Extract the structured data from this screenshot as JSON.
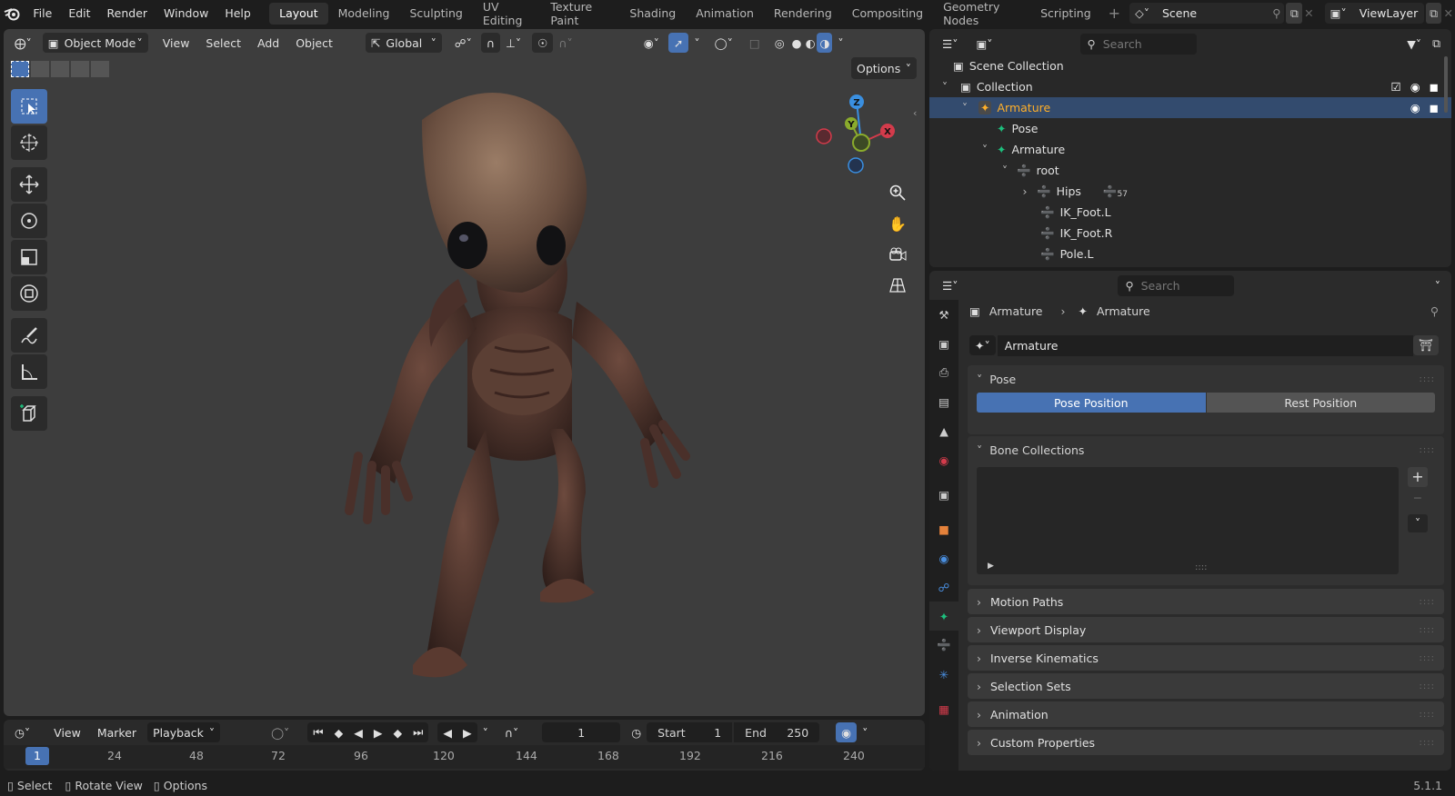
{
  "top_menu": [
    "File",
    "Edit",
    "Render",
    "Window",
    "Help"
  ],
  "workspaces": [
    "Layout",
    "Modeling",
    "Sculpting",
    "UV Editing",
    "Texture Paint",
    "Shading",
    "Animation",
    "Rendering",
    "Compositing",
    "Geometry Nodes",
    "Scripting"
  ],
  "active_workspace": "Layout",
  "scene_name": "Scene",
  "view_layer": "ViewLayer",
  "viewport": {
    "mode": "Object Mode",
    "menus": [
      "View",
      "Select",
      "Add",
      "Object"
    ],
    "orientation": "Global",
    "options_label": "Options",
    "gizmo_axes": {
      "z": "Z",
      "y": "Y",
      "x": "X"
    }
  },
  "timeline": {
    "menus": [
      "View",
      "Marker",
      "Playback"
    ],
    "current_frame": "1",
    "start_label": "Start",
    "start_value": "1",
    "end_label": "End",
    "end_value": "250",
    "ruler_current": "1",
    "ruler_ticks": [
      "24",
      "48",
      "72",
      "96",
      "120",
      "144",
      "168",
      "192",
      "216",
      "240"
    ]
  },
  "outliner": {
    "search_placeholder": "Search",
    "items": [
      "Scene Collection",
      "Collection",
      "Armature",
      "Pose",
      "Armature",
      "root",
      "Hips",
      "IK_Foot.L",
      "IK_Foot.R",
      "Pole.L"
    ],
    "hips_badge": "57"
  },
  "properties": {
    "search_placeholder": "Search",
    "breadcrumb": [
      "Armature",
      "Armature"
    ],
    "datablock_name": "Armature",
    "pose_panel": "Pose",
    "pose_position": "Pose Position",
    "rest_position": "Rest Position",
    "bone_collections": "Bone Collections",
    "panels": [
      "Motion Paths",
      "Viewport Display",
      "Inverse Kinematics",
      "Selection Sets",
      "Animation",
      "Custom Properties"
    ]
  },
  "status_bar": {
    "items": [
      "Select",
      "Rotate View",
      "Options"
    ],
    "version": "5.1.1"
  },
  "colors": {
    "accent": "#4772b3",
    "selection_text": "#ffaf29",
    "bone_green": "#1dbf7d",
    "axis_x": "#d33b4b",
    "axis_y": "#8aab2c",
    "axis_z": "#3a8fe0"
  }
}
